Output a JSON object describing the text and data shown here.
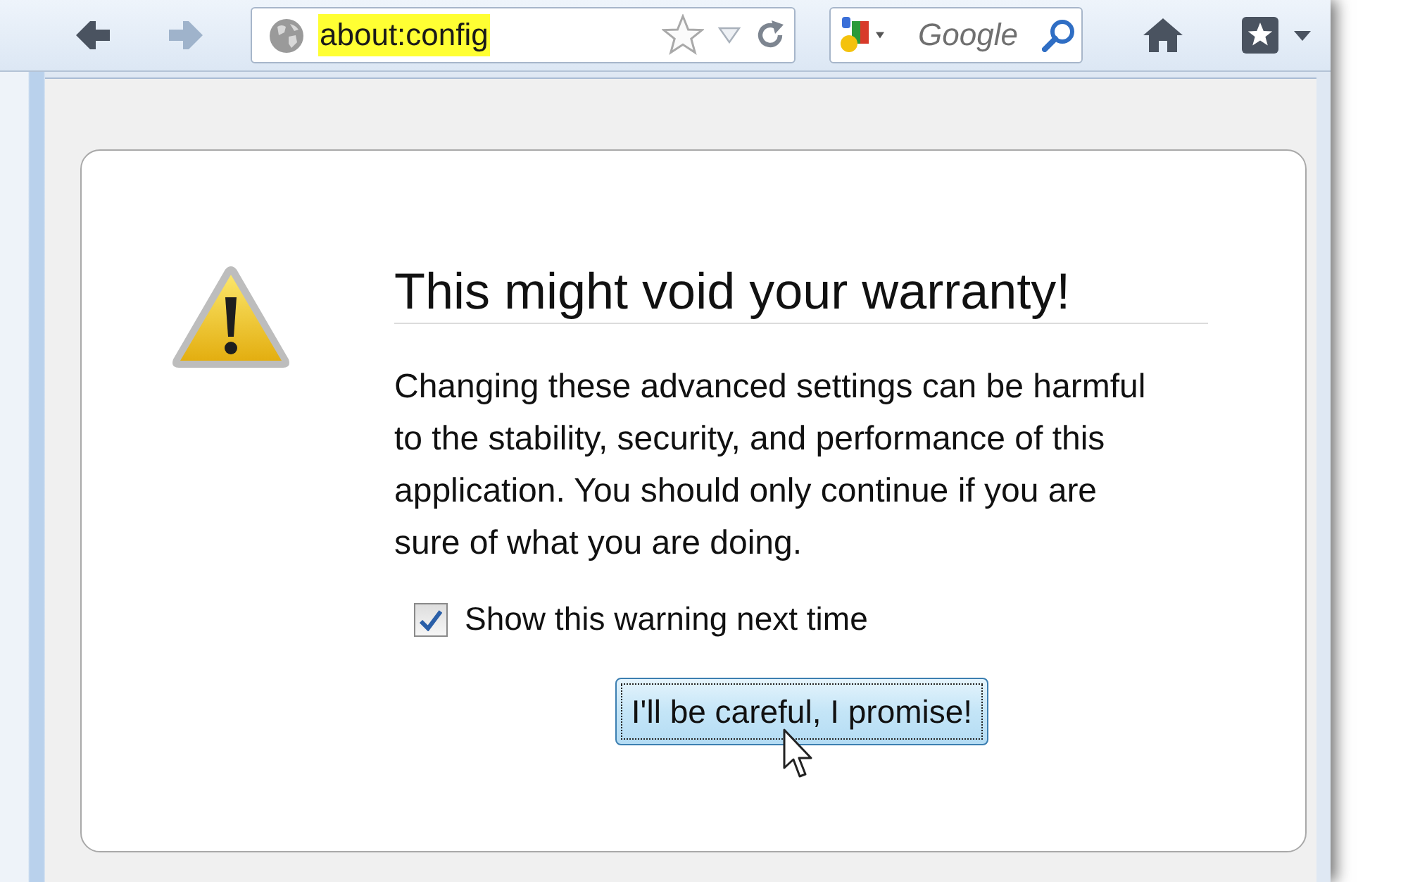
{
  "toolbar": {
    "nav_buttons": [
      {
        "kind": "back",
        "disabled": false
      },
      {
        "kind": "forward",
        "disabled": true
      }
    ],
    "address_bar": {
      "value": "about:config",
      "highlighted": true
    },
    "search_bar": {
      "placeholder": "Google"
    }
  },
  "warning_page": {
    "title": "This might void your warranty!",
    "message": "Changing these advanced settings can be harmful to the stability, security, and performance of this application. You should only continue if you are sure of what you are doing.",
    "checkbox": {
      "label": "Show this warning next time",
      "checked": true
    },
    "button": {
      "label": "I'll be careful, I promise!",
      "focused": true
    }
  }
}
